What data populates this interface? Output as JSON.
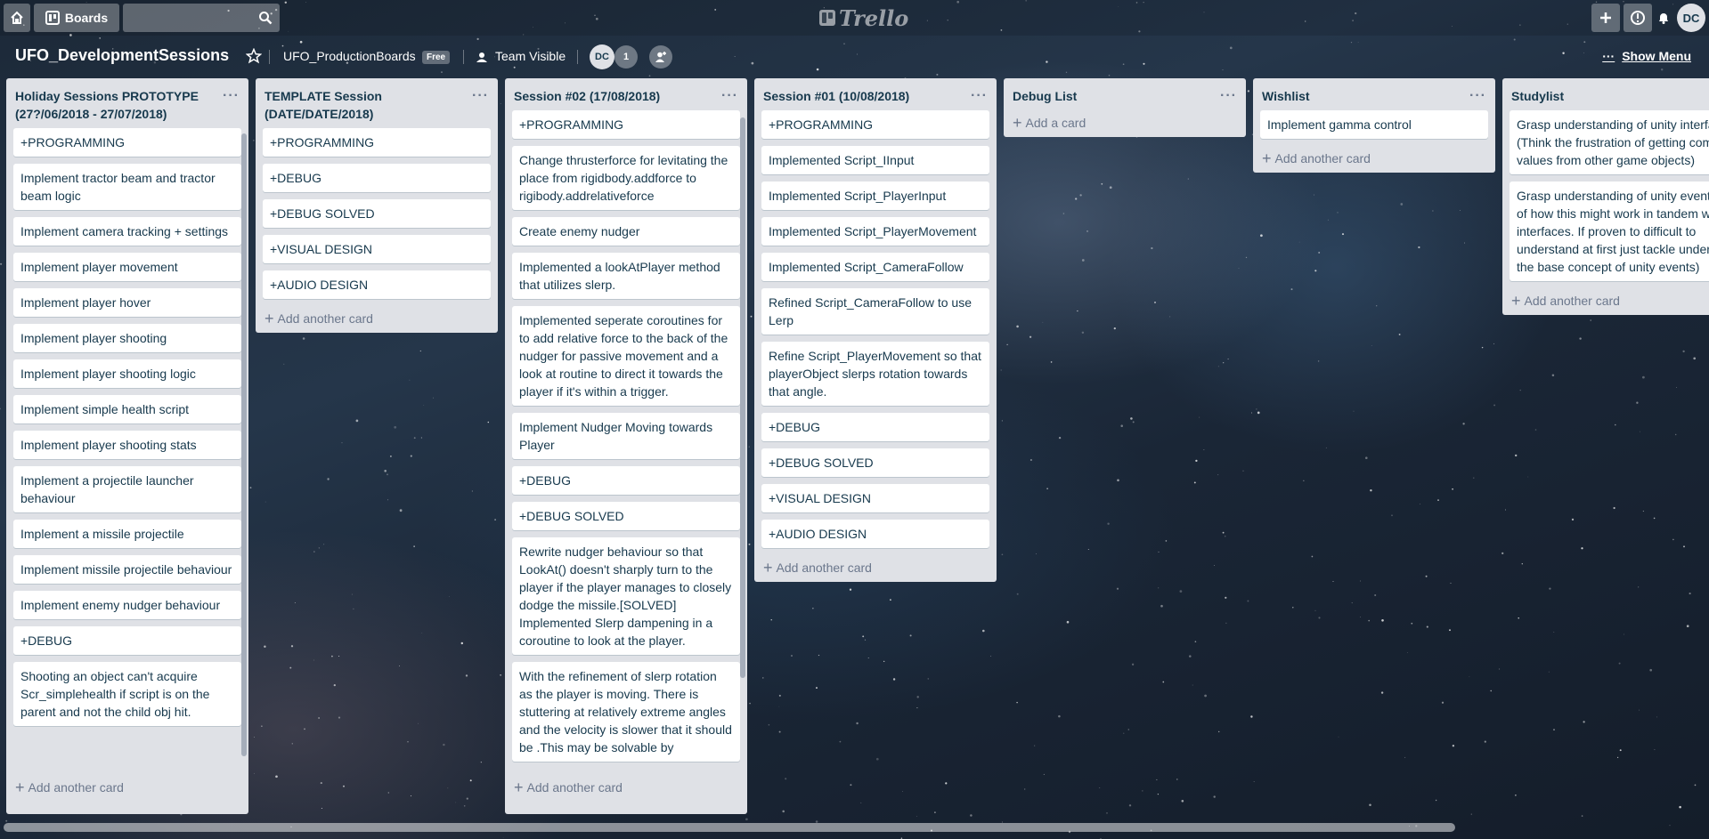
{
  "header": {
    "boards_label": "Boards",
    "search_placeholder": "",
    "logo_text": "Trello",
    "avatar_initials": "DC"
  },
  "board": {
    "title": "UFO_DevelopmentSessions",
    "team": "UFO_ProductionBoards",
    "team_badge": "Free",
    "visibility": "Team Visible",
    "member_initials": "DC",
    "member_count": "1",
    "show_menu": "Show Menu"
  },
  "lists": [
    {
      "title": "Holiday Sessions PROTOTYPE (27?/06/2018 - 27/07/2018)",
      "cards": [
        "+PROGRAMMING",
        "Implement tractor beam and tractor beam logic",
        "Implement camera tracking + settings",
        "Implement player movement",
        "Implement player hover",
        "Implement player shooting",
        "Implement player shooting logic",
        "Implement simple health script",
        "Implement player shooting stats",
        "Implement a projectile launcher behaviour",
        "Implement a missile projectile",
        "Implement missile projectile behaviour",
        "Implement enemy nudger behaviour",
        "+DEBUG",
        "Shooting an object can't acquire Scr_simplehealth if script is on the parent and not the child obj hit."
      ],
      "add_label": "Add another card"
    },
    {
      "title": "TEMPLATE Session (DATE/DATE/2018)",
      "cards": [
        "+PROGRAMMING",
        "+DEBUG",
        "+DEBUG SOLVED",
        "+VISUAL DESIGN",
        "+AUDIO DESIGN"
      ],
      "add_label": "Add another card"
    },
    {
      "title": "Session #02 (17/08/2018)",
      "cards": [
        "+PROGRAMMING",
        "Change thrusterforce for levitating the place from rigidbody.addforce to rigibody.addrelativeforce",
        "Create enemy nudger",
        "Implemented a lookAtPlayer method that utilizes slerp.",
        "Implemented seperate coroutines for to add relative force to the back of the nudger for passive movement and a look at routine to direct it towards the player if it's within a trigger.",
        "Implement Nudger Moving towards Player",
        "+DEBUG",
        "+DEBUG SOLVED",
        "Rewrite nudger behaviour so that LookAt() doesn't sharply turn to the player if the player manages to closely dodge the missile.[SOLVED] Implemented Slerp dampening in a coroutine to look at the player.",
        "With the refinement of slerp rotation as the player is moving. There is stuttering at relatively extreme angles and the velocity is slower that it should be .This may be solvable by"
      ],
      "add_label": "Add another card"
    },
    {
      "title": "Session #01 (10/08/2018)",
      "cards": [
        "+PROGRAMMING",
        "Implemented Script_IInput",
        "Implemented Script_PlayerInput",
        "Implemented Script_PlayerMovement",
        "Implemented Script_CameraFollow",
        "Refined Script_CameraFollow to use Lerp",
        "Refine Script_PlayerMovement so that playerObject slerps rotation towards that angle.",
        "+DEBUG",
        "+DEBUG SOLVED",
        "+VISUAL DESIGN",
        "+AUDIO DESIGN"
      ],
      "add_label": "Add another card"
    },
    {
      "title": "Debug List",
      "cards": [],
      "add_label": "Add a card"
    },
    {
      "title": "Wishlist",
      "cards": [
        "Implement gamma control"
      ],
      "add_label": "Add another card"
    },
    {
      "title": "Studylist",
      "cards": [
        "Grasp understanding of unity interfaces..(Think the frustration of getting component values from other game objects)",
        "Grasp understanding of unity events (Think of how this might work in tandem with interfaces. If proven to difficult to understand at first just tackle understanding the base concept of unity events)"
      ],
      "add_label": "Add another card"
    }
  ],
  "icons": {
    "home": "home-icon",
    "boards": "boards-icon",
    "search": "search-icon",
    "add": "plus-icon",
    "info": "info-icon",
    "notifications": "bell-icon",
    "star": "star-icon",
    "visibility": "team-icon",
    "invite": "add-member-icon",
    "menu": "more-icon"
  },
  "colors": {
    "list_bg": "#dfe1e6",
    "card_bg": "#ffffff",
    "text": "#17394d",
    "muted": "#6b778c"
  }
}
